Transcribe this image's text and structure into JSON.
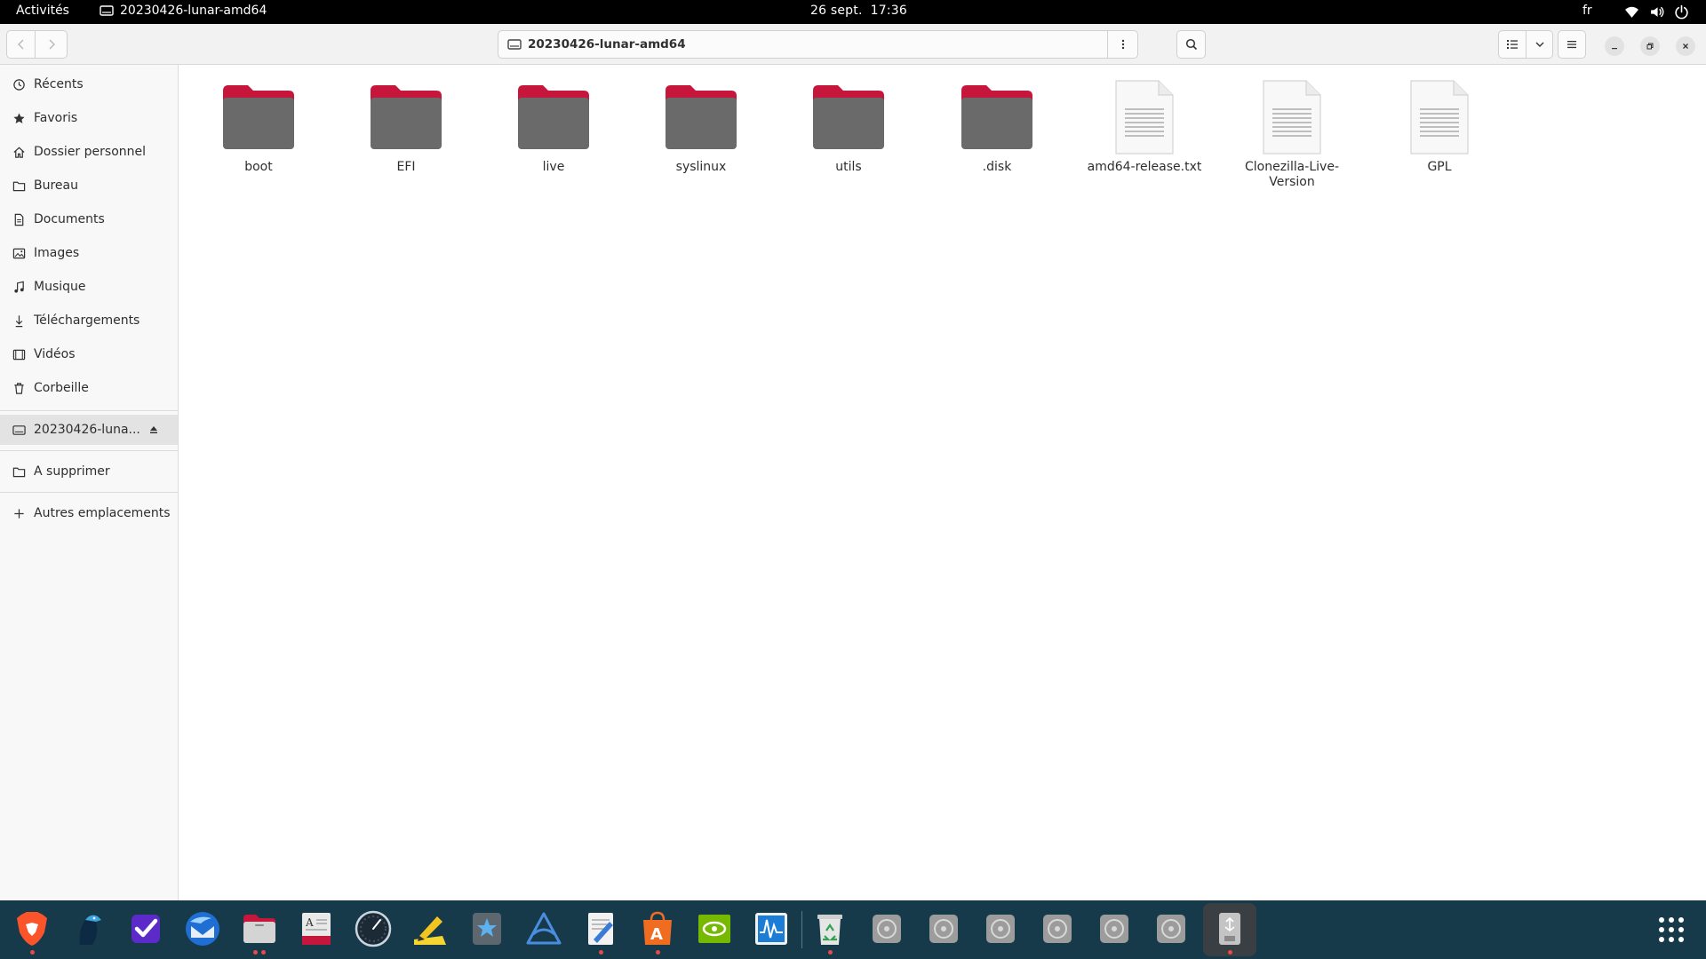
{
  "topbar": {
    "activities": "Activités",
    "app_name": "20230426-lunar-amd64",
    "date": "26 sept.",
    "time": "17:36",
    "language": "fr"
  },
  "headerbar": {
    "location": "20230426-lunar-amd64"
  },
  "sidebar": {
    "items": [
      {
        "label": "Récents",
        "icon": "clock-icon"
      },
      {
        "label": "Favoris",
        "icon": "star-icon"
      },
      {
        "label": "Dossier personnel",
        "icon": "home-icon"
      },
      {
        "label": "Bureau",
        "icon": "folder-icon"
      },
      {
        "label": "Documents",
        "icon": "document-icon"
      },
      {
        "label": "Images",
        "icon": "image-icon"
      },
      {
        "label": "Musique",
        "icon": "music-icon"
      },
      {
        "label": "Téléchargements",
        "icon": "download-icon"
      },
      {
        "label": "Vidéos",
        "icon": "video-icon"
      },
      {
        "label": "Corbeille",
        "icon": "trash-icon"
      }
    ],
    "mounted": {
      "label": "20230426-luna...",
      "icon": "drive-icon"
    },
    "bookmark": {
      "label": "A supprimer",
      "icon": "folder-icon"
    },
    "other": {
      "label": "Autres emplacements",
      "icon": "plus-icon"
    }
  },
  "files": [
    {
      "name": "boot",
      "type": "folder"
    },
    {
      "name": "EFI",
      "type": "folder"
    },
    {
      "name": "live",
      "type": "folder"
    },
    {
      "name": "syslinux",
      "type": "folder"
    },
    {
      "name": "utils",
      "type": "folder"
    },
    {
      "name": ".disk",
      "type": "folder"
    },
    {
      "name": "amd64-release.txt",
      "type": "text"
    },
    {
      "name": "Clonezilla-Live-Version",
      "type": "text"
    },
    {
      "name": "GPL",
      "type": "text"
    }
  ],
  "dock": {
    "apps": [
      "brave-browser-icon",
      "bird-app-icon",
      "tasks-icon",
      "thunderbird-icon",
      "files-icon",
      "dictionary-icon",
      "speedometer-icon",
      "notes-icon",
      "image-viewer-icon",
      "affine-icon",
      "text-editor-icon",
      "software-center-icon",
      "nvidia-settings-icon",
      "system-monitor-icon",
      "trash-icon",
      "disc-icon",
      "disc-icon",
      "disc-icon",
      "disc-icon",
      "disc-icon",
      "disc-icon",
      "usb-drive-icon"
    ]
  },
  "colors": {
    "folder_tab": "#c7163b",
    "folder_body": "#6a6a6a",
    "dock_bg": "#173a4a",
    "running_dot": "#e84a4a"
  }
}
